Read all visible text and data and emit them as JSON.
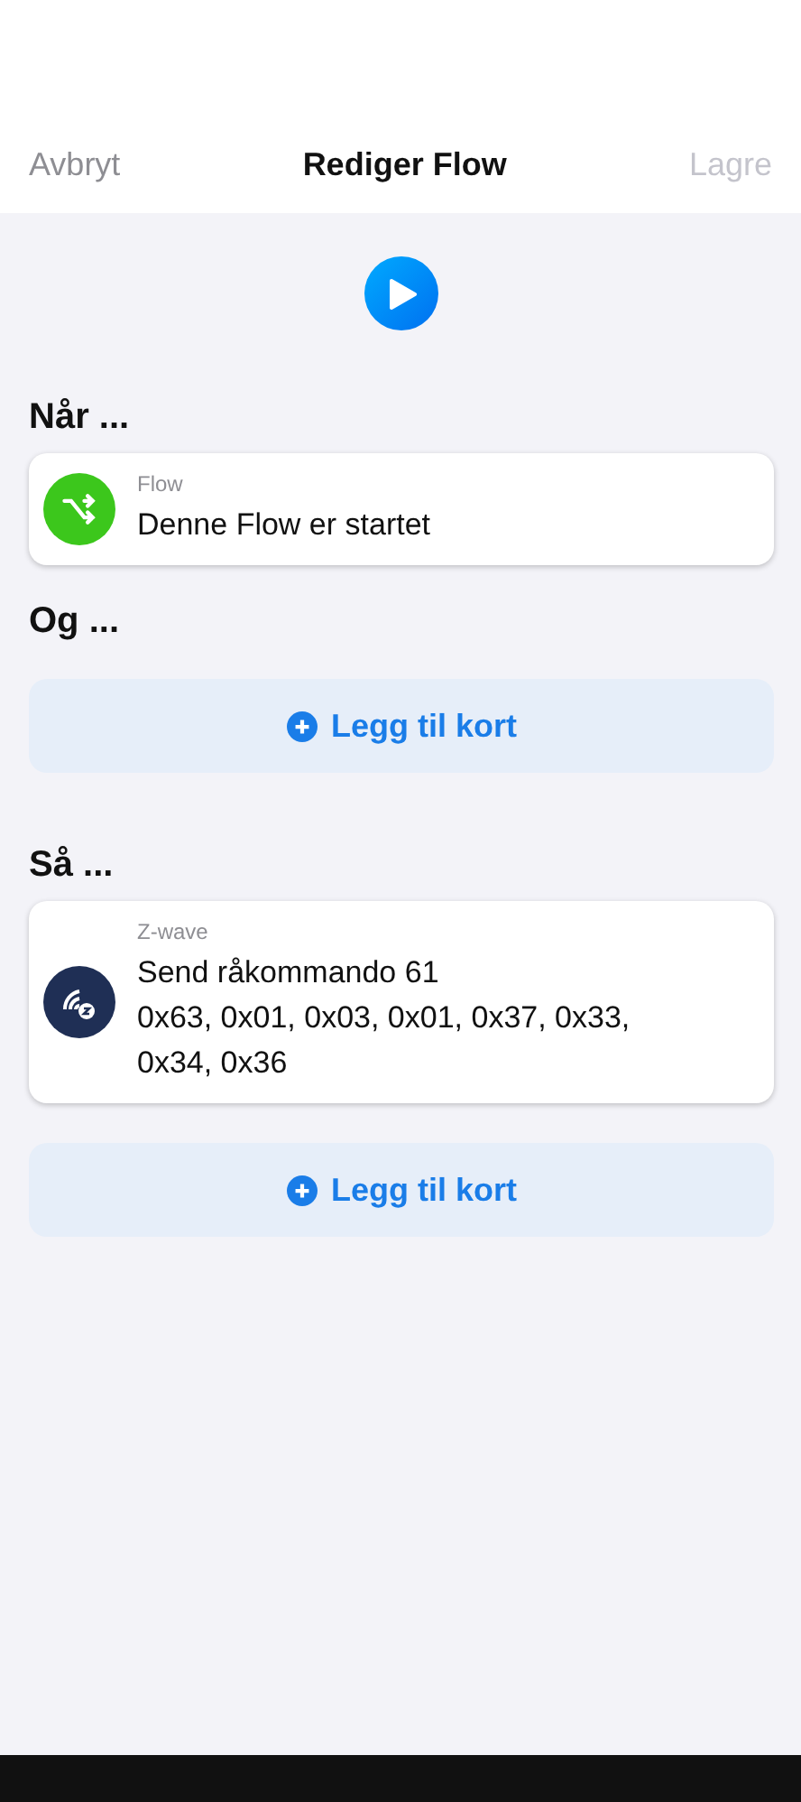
{
  "header": {
    "cancel": "Avbryt",
    "title": "Rediger Flow",
    "save": "Lagre",
    "save_disabled": true
  },
  "sections": [
    {
      "heading": "Når ...",
      "cards": [
        {
          "kind": "flow",
          "source": "Flow",
          "lines": [
            "Denne Flow er startet"
          ]
        }
      ]
    },
    {
      "heading": "Og ...",
      "add_label": "Legg til kort"
    },
    {
      "heading": "Så ...",
      "cards": [
        {
          "kind": "zwave",
          "source": "Z-wave",
          "lines": [
            "Send råkommando 61",
            "0x63, 0x01, 0x03, 0x01, 0x37, 0x33,",
            "0x34, 0x36"
          ]
        }
      ],
      "add_label": "Legg til kort"
    }
  ]
}
